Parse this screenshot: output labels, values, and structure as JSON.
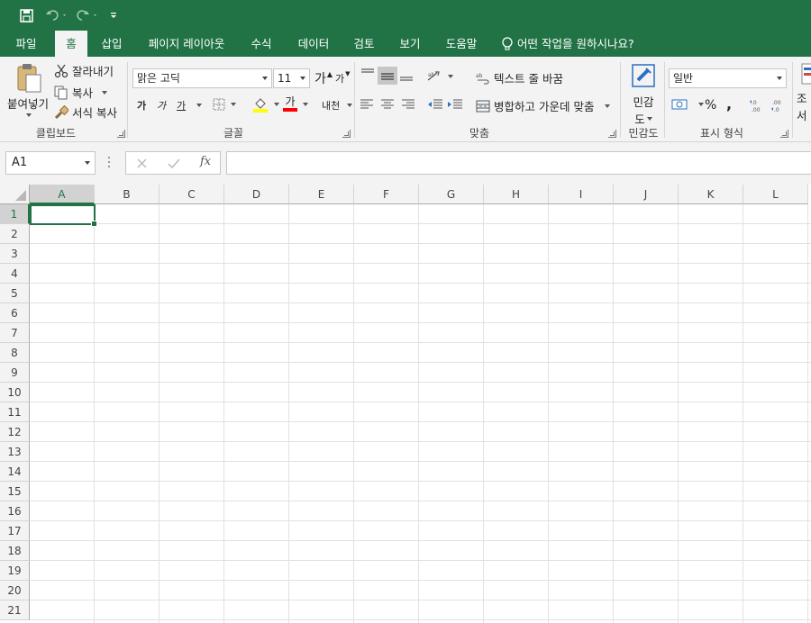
{
  "tabs": [
    "파일",
    "홈",
    "삽입",
    "페이지 레이아웃",
    "수식",
    "데이터",
    "검토",
    "보기",
    "도움말"
  ],
  "active_tab": "홈",
  "tell_me": "어떤 작업을 원하시나요?",
  "clipboard": {
    "paste": "붙여넣기",
    "cut": "잘라내기",
    "copy": "복사",
    "format_painter": "서식 복사",
    "label": "클립보드"
  },
  "font": {
    "name": "맑은 고딕",
    "size": "11",
    "grow": "가",
    "shrink": "가",
    "bold": "가",
    "italic": "가",
    "underline": "가",
    "font_color": "가",
    "phonetic": "내천",
    "label": "글꼴"
  },
  "alignment": {
    "wrap_text": "텍스트 줄 바꿈",
    "merge_center": "병합하고 가운데 맞춤",
    "label": "맞춤"
  },
  "sensitivity": {
    "line1": "민감",
    "line2": "도",
    "label": "민감도"
  },
  "number": {
    "format": "일반",
    "percent": "%",
    "comma": ",",
    "label": "표시 형식"
  },
  "styles_partial": {
    "line1": "조",
    "line2": "서"
  },
  "namebox": "A1",
  "formula": "",
  "columns": [
    "A",
    "B",
    "C",
    "D",
    "E",
    "F",
    "G",
    "H",
    "I",
    "J",
    "K",
    "L"
  ],
  "rows": [
    "1",
    "2",
    "3",
    "4",
    "5",
    "6",
    "7",
    "8",
    "9",
    "10",
    "11",
    "12",
    "13",
    "14",
    "15",
    "16",
    "17",
    "18",
    "19",
    "20",
    "21"
  ],
  "colors": {
    "accent": "#217346",
    "ribbon_bg": "#f3f3f3",
    "highlight_yellow": "#ffff00",
    "font_red": "#ff0000"
  }
}
